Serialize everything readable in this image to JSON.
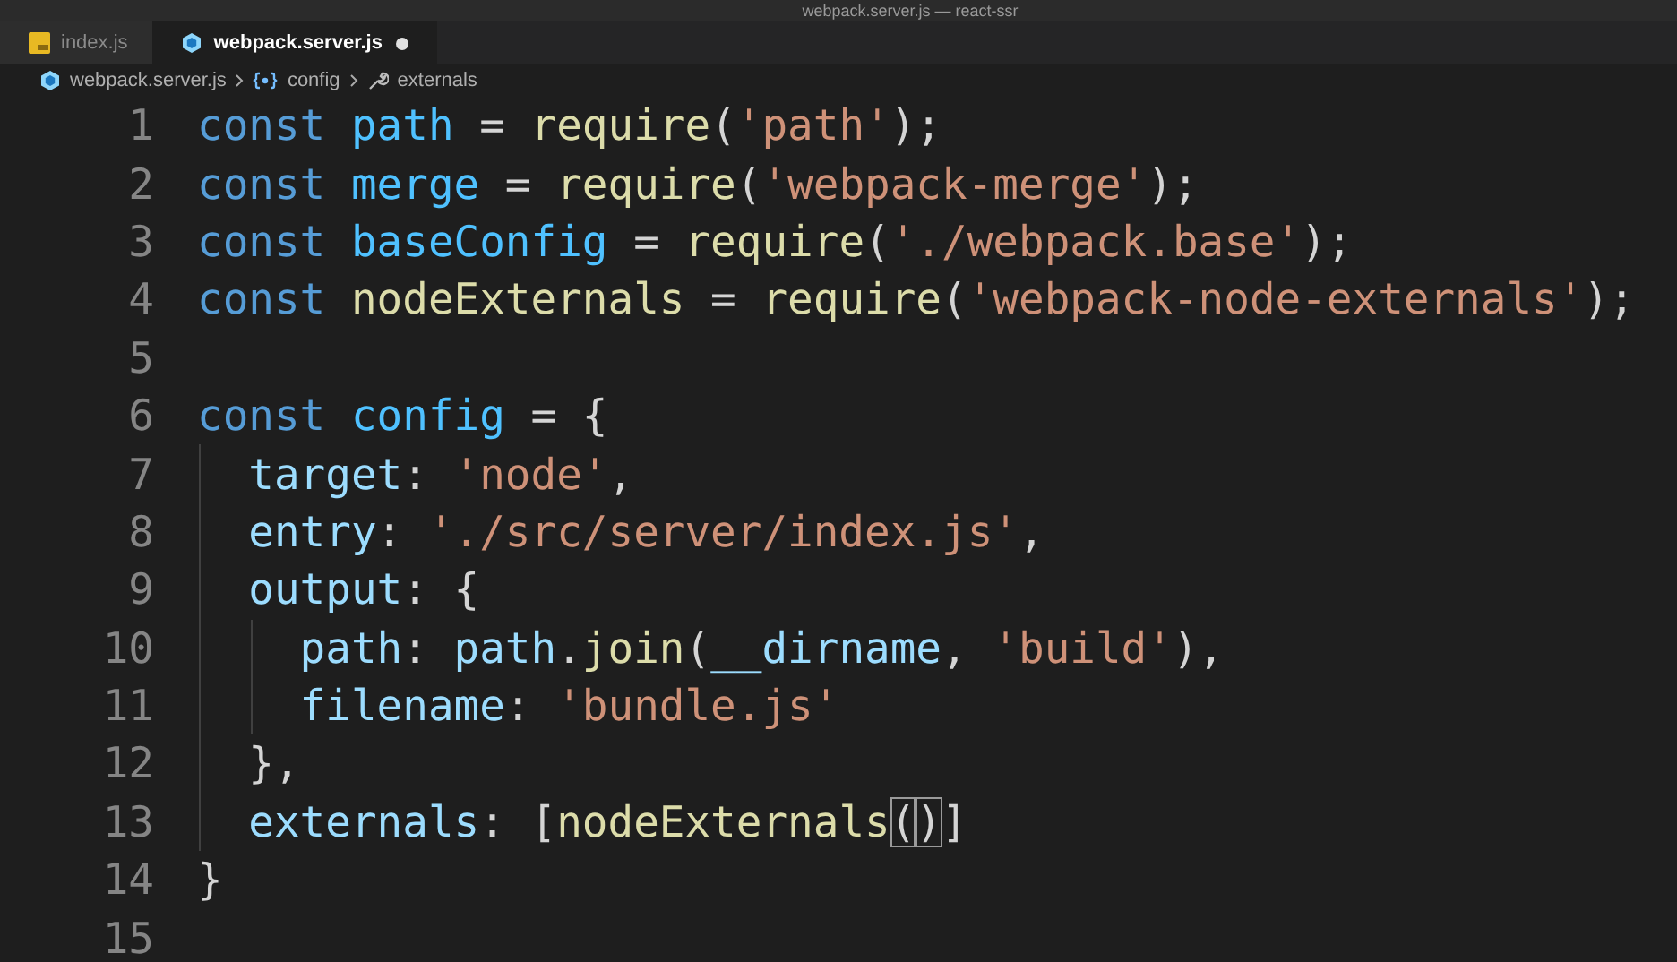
{
  "window": {
    "title": "webpack.server.js — react-ssr"
  },
  "tabs": [
    {
      "label": "index.js",
      "kind": "js",
      "selected": false,
      "modified": false
    },
    {
      "label": "webpack.server.js",
      "kind": "webpack",
      "selected": true,
      "modified": true
    }
  ],
  "breadcrumbs": [
    {
      "label": "webpack.server.js",
      "kind": "file"
    },
    {
      "label": "config",
      "kind": "object"
    },
    {
      "label": "externals",
      "kind": "property"
    }
  ],
  "editor": {
    "lines": [
      {
        "number": "1",
        "tokens": [
          {
            "kind": "keyword",
            "text": "const "
          },
          {
            "kind": "variable",
            "text": "path"
          },
          {
            "kind": "punct",
            "text": " = "
          },
          {
            "kind": "function",
            "text": "require"
          },
          {
            "kind": "punct",
            "text": "("
          },
          {
            "kind": "string",
            "text": "'path'"
          },
          {
            "kind": "punct",
            "text": ");"
          }
        ]
      },
      {
        "number": "2",
        "tokens": [
          {
            "kind": "keyword",
            "text": "const "
          },
          {
            "kind": "variable",
            "text": "merge"
          },
          {
            "kind": "punct",
            "text": " = "
          },
          {
            "kind": "function",
            "text": "require"
          },
          {
            "kind": "punct",
            "text": "("
          },
          {
            "kind": "string",
            "text": "'webpack-merge'"
          },
          {
            "kind": "punct",
            "text": ");"
          }
        ]
      },
      {
        "number": "3",
        "tokens": [
          {
            "kind": "keyword",
            "text": "const "
          },
          {
            "kind": "variable",
            "text": "baseConfig"
          },
          {
            "kind": "punct",
            "text": " = "
          },
          {
            "kind": "function",
            "text": "require"
          },
          {
            "kind": "punct",
            "text": "("
          },
          {
            "kind": "string",
            "text": "'./webpack.base'"
          },
          {
            "kind": "punct",
            "text": ");"
          }
        ]
      },
      {
        "number": "4",
        "tokens": [
          {
            "kind": "keyword",
            "text": "const "
          },
          {
            "kind": "function",
            "text": "nodeExternals"
          },
          {
            "kind": "punct",
            "text": " = "
          },
          {
            "kind": "function",
            "text": "require"
          },
          {
            "kind": "punct",
            "text": "("
          },
          {
            "kind": "string",
            "text": "'webpack-node-externals'"
          },
          {
            "kind": "punct",
            "text": ");"
          }
        ]
      },
      {
        "number": "5"
      },
      {
        "number": "6",
        "tokens": [
          {
            "kind": "keyword",
            "text": "const "
          },
          {
            "kind": "variable",
            "text": "config"
          },
          {
            "kind": "punct",
            "text": " = {"
          }
        ]
      },
      {
        "number": "7",
        "tokens": [
          {
            "kind": "property",
            "text": "  target"
          },
          {
            "kind": "punct",
            "text": ": "
          },
          {
            "kind": "string",
            "text": "'node'"
          },
          {
            "kind": "punct",
            "text": ","
          }
        ]
      },
      {
        "number": "8",
        "tokens": [
          {
            "kind": "property",
            "text": "  entry"
          },
          {
            "kind": "punct",
            "text": ": "
          },
          {
            "kind": "string",
            "text": "'./src/server/index.js'"
          },
          {
            "kind": "punct",
            "text": ","
          }
        ]
      },
      {
        "number": "9",
        "tokens": [
          {
            "kind": "property",
            "text": "  output"
          },
          {
            "kind": "punct",
            "text": ": {"
          }
        ]
      },
      {
        "number": "10",
        "tokens": [
          {
            "kind": "property",
            "text": "    path"
          },
          {
            "kind": "punct",
            "text": ": "
          },
          {
            "kind": "property",
            "text": "path"
          },
          {
            "kind": "punct",
            "text": "."
          },
          {
            "kind": "function",
            "text": "join"
          },
          {
            "kind": "punct",
            "text": "("
          },
          {
            "kind": "property",
            "text": "__dirname"
          },
          {
            "kind": "punct",
            "text": ", "
          },
          {
            "kind": "string",
            "text": "'build'"
          },
          {
            "kind": "punct",
            "text": "),"
          }
        ]
      },
      {
        "number": "11",
        "tokens": [
          {
            "kind": "property",
            "text": "    filename"
          },
          {
            "kind": "punct",
            "text": ": "
          },
          {
            "kind": "string",
            "text": "'bundle.js'"
          }
        ]
      },
      {
        "number": "12",
        "tokens": [
          {
            "kind": "punct",
            "text": "  },"
          }
        ]
      },
      {
        "number": "13",
        "tokens": [
          {
            "kind": "property",
            "text": "  externals"
          },
          {
            "kind": "punct",
            "text": ": ["
          },
          {
            "kind": "function",
            "text": "nodeExternals"
          },
          {
            "kind": "punct",
            "text": "(",
            "matched": true
          },
          {
            "kind": "punct",
            "text": ")",
            "matched": true
          },
          {
            "kind": "punct",
            "text": "]"
          }
        ]
      },
      {
        "number": "14",
        "tokens": [
          {
            "kind": "punct",
            "text": "}"
          }
        ]
      },
      {
        "number": "15"
      }
    ]
  }
}
